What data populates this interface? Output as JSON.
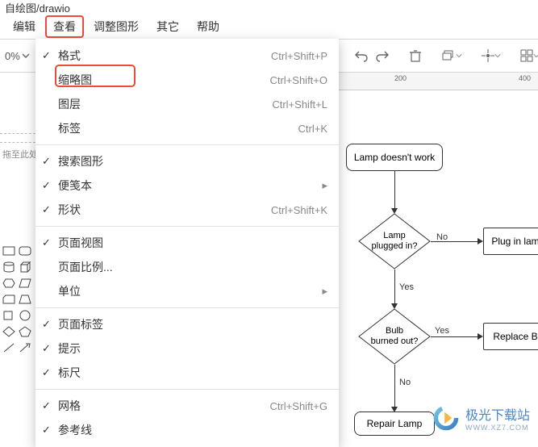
{
  "app_title": "自绘图/drawio",
  "menubar": {
    "items": [
      {
        "label": "编辑",
        "highlighted": false
      },
      {
        "label": "查看",
        "highlighted": true
      },
      {
        "label": "调整图形",
        "highlighted": false
      },
      {
        "label": "其它",
        "highlighted": false
      },
      {
        "label": "帮助",
        "highlighted": false
      }
    ]
  },
  "toolbar": {
    "zoom_label": "0%"
  },
  "ruler": {
    "ticks": [
      "200",
      "400"
    ]
  },
  "sidebar": {
    "drag_hint": "拖至此处"
  },
  "dropdown": {
    "groups": [
      [
        {
          "label": "格式",
          "checked": true,
          "shortcut": "Ctrl+Shift+P"
        },
        {
          "label": "缩略图",
          "checked": false,
          "shortcut": "Ctrl+Shift+O",
          "highlight": true
        },
        {
          "label": "图层",
          "checked": false,
          "shortcut": "Ctrl+Shift+L"
        },
        {
          "label": "标签",
          "checked": false,
          "shortcut": "Ctrl+K"
        }
      ],
      [
        {
          "label": "搜索图形",
          "checked": true,
          "shortcut": ""
        },
        {
          "label": "便笺本",
          "checked": true,
          "shortcut": "",
          "submenu": true
        },
        {
          "label": "形状",
          "checked": true,
          "shortcut": "Ctrl+Shift+K"
        }
      ],
      [
        {
          "label": "页面视图",
          "checked": true,
          "shortcut": ""
        },
        {
          "label": "页面比例...",
          "checked": false,
          "shortcut": ""
        },
        {
          "label": "单位",
          "checked": false,
          "shortcut": "",
          "submenu": true
        }
      ],
      [
        {
          "label": "页面标签",
          "checked": true,
          "shortcut": ""
        },
        {
          "label": "提示",
          "checked": true,
          "shortcut": ""
        },
        {
          "label": "标尺",
          "checked": true,
          "shortcut": ""
        }
      ],
      [
        {
          "label": "网格",
          "checked": true,
          "shortcut": "Ctrl+Shift+G"
        },
        {
          "label": "参考线",
          "checked": true,
          "shortcut": ""
        }
      ]
    ]
  },
  "flowchart": {
    "start": "Lamp doesn't work",
    "d1": "Lamp\nplugged in?",
    "d1_no": "No",
    "d1_yes": "Yes",
    "r1": "Plug in lam",
    "d2": "Bulb\nburned out?",
    "d2_yes": "Yes",
    "d2_no": "No",
    "r2": "Replace B",
    "end": "Repair Lamp"
  },
  "watermark": {
    "text": "极光下载站",
    "sub": "WWW.XZ7.COM"
  }
}
